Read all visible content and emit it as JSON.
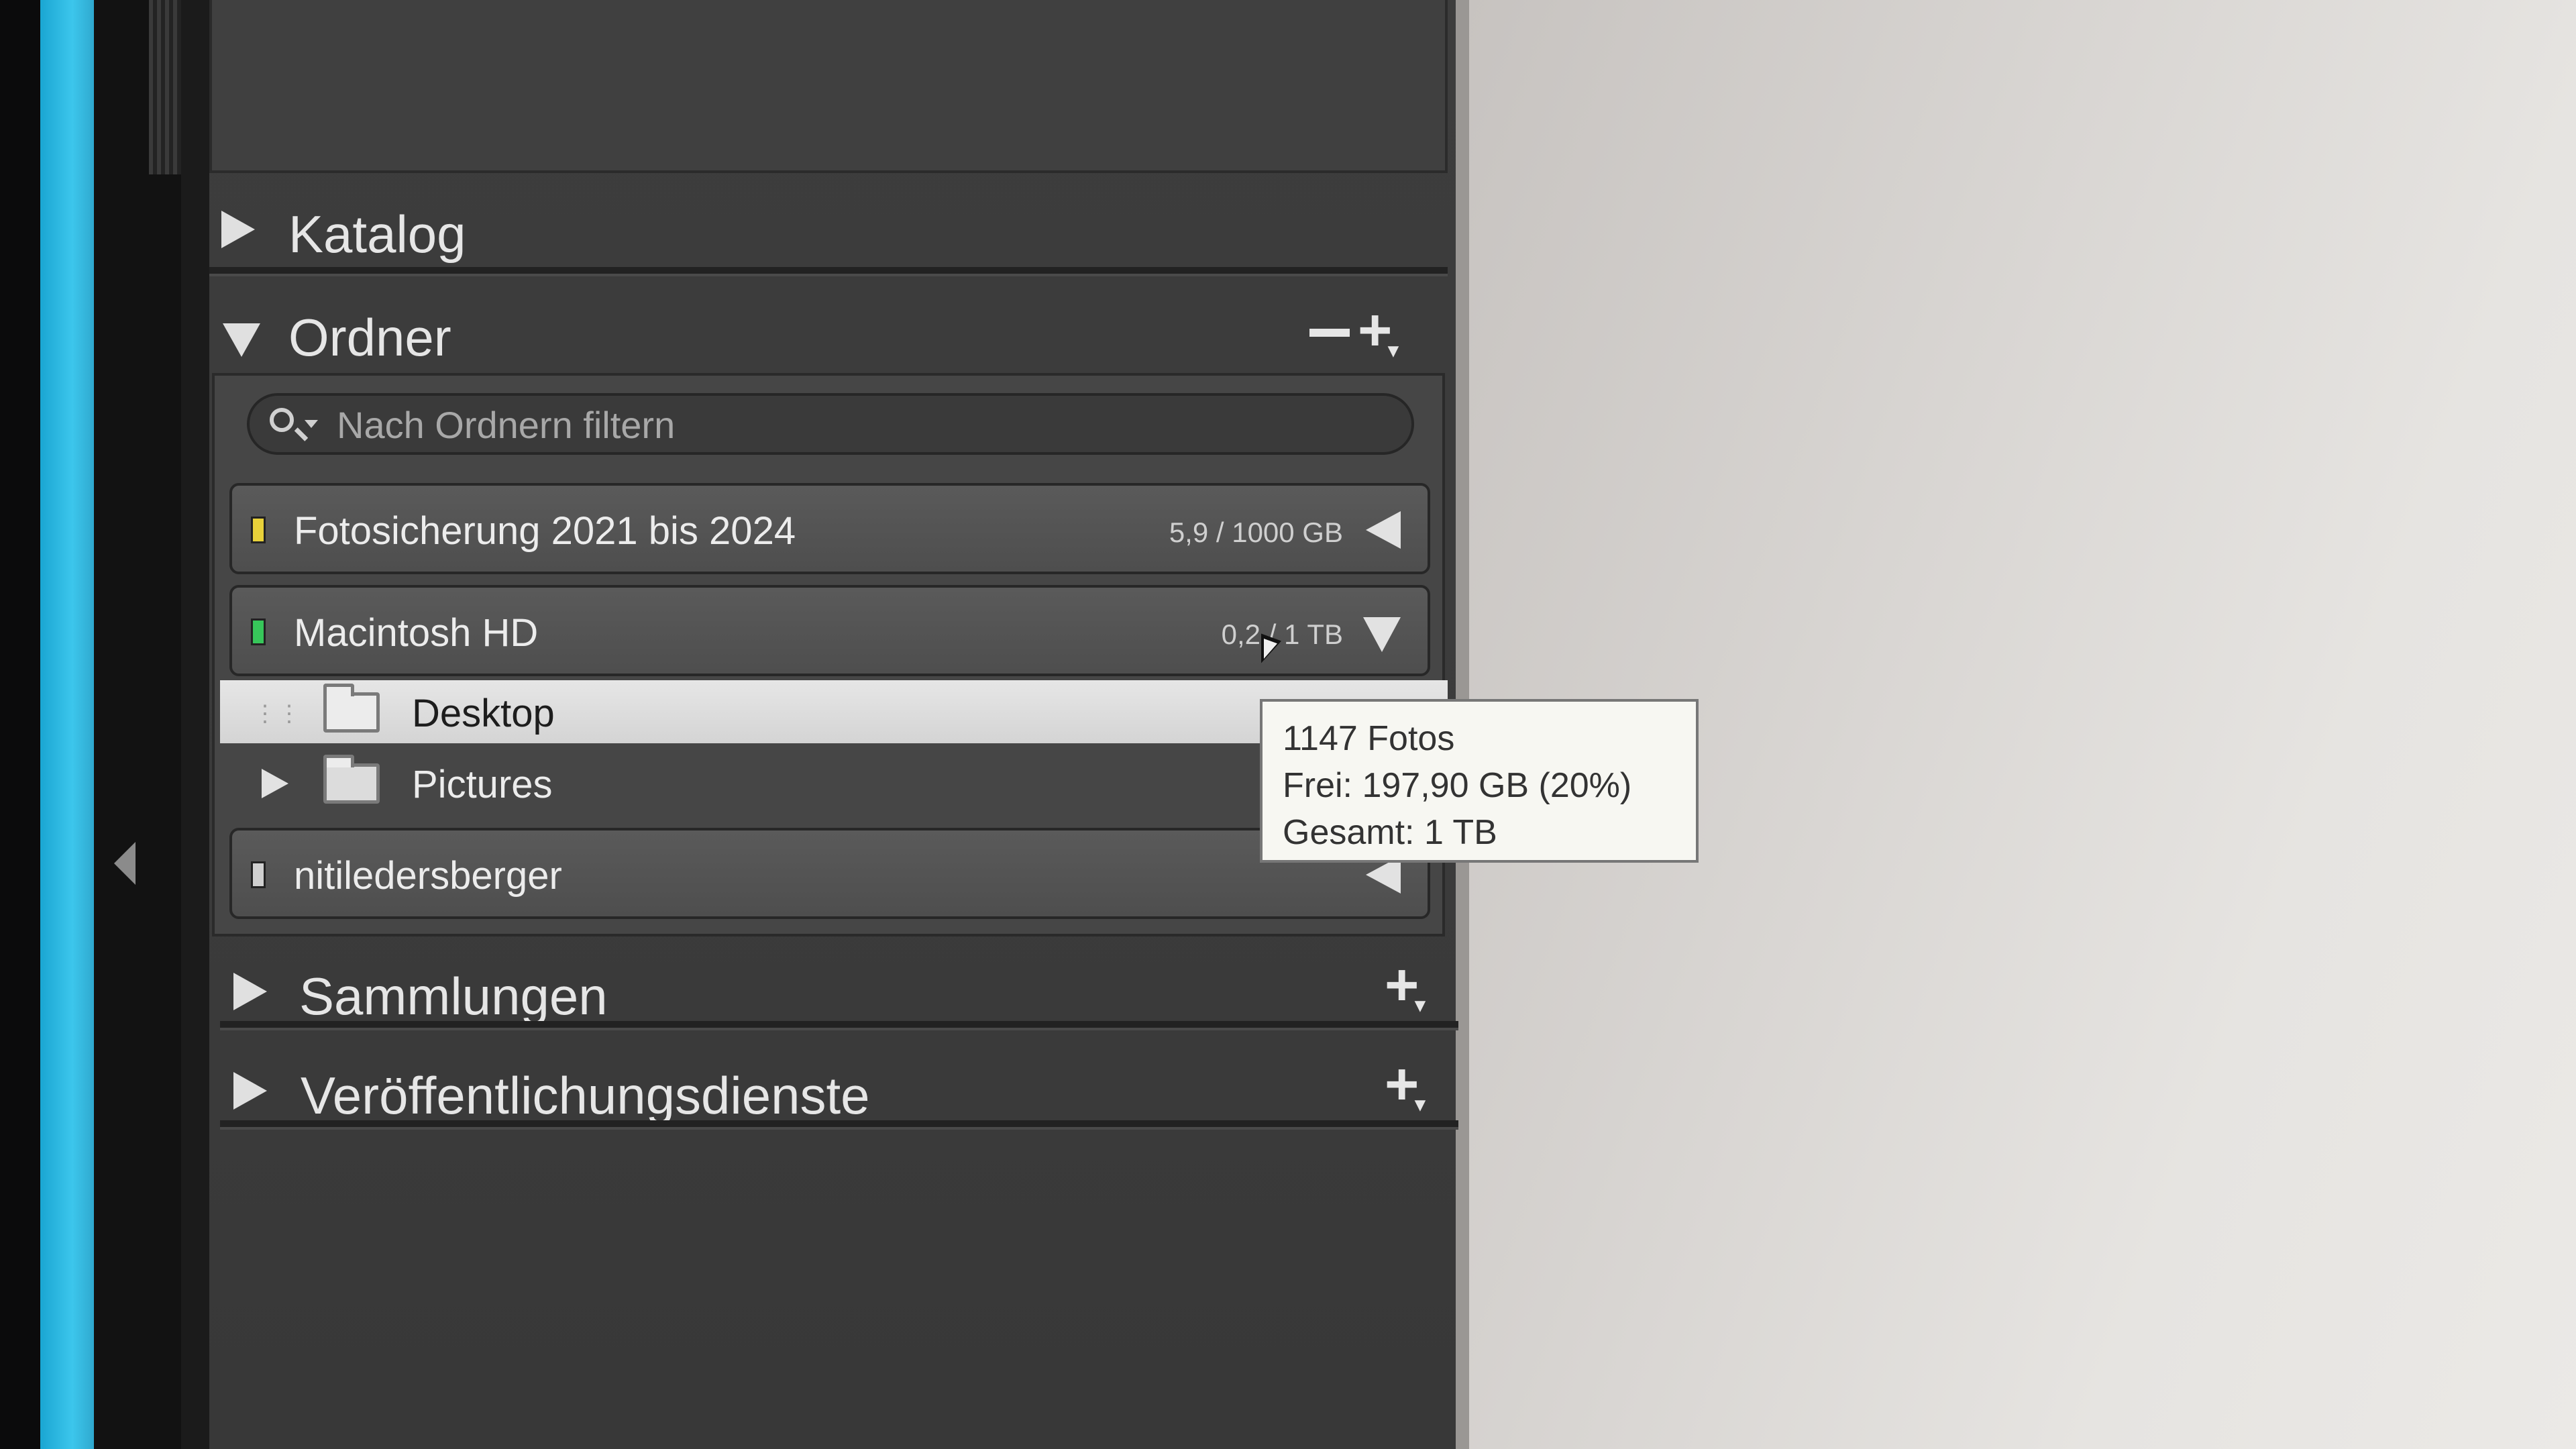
{
  "panel": {
    "sections": {
      "katalog": "Katalog",
      "ordner": "Ordner",
      "sammlungen": "Sammlungen",
      "veroeffentlichungsdienste": "Veröffentlichungsdienste"
    },
    "ordner_actions": {
      "remove": "−",
      "add": "+"
    },
    "search": {
      "placeholder": "Nach Ordnern filtern"
    },
    "volumes": [
      {
        "name": "Fotosicherung 2021 bis 2024",
        "capacity": "5,9 / 1000 GB",
        "indicator": "#e8d13a",
        "expanded": false
      },
      {
        "name": "Macintosh HD",
        "capacity": "0,2 / 1 TB",
        "indicator": "#37c65a",
        "expanded": true
      },
      {
        "name": "nitiledersberger",
        "capacity": "",
        "indicator": "#cfcfcf",
        "expanded": false
      }
    ],
    "folders": [
      {
        "name": "Desktop",
        "selected": true
      },
      {
        "name": "Pictures",
        "selected": false
      }
    ],
    "collapse_icon": "triangle-left-icon"
  },
  "tooltip": {
    "line1": "1147 Fotos",
    "line2": "Frei: 197,90 GB (20%)",
    "line3": "Gesamt: 1 TB"
  },
  "colors": {
    "panel_bg": "#3c3c3c",
    "selected_row": "#dcdcdc",
    "tooltip_bg": "#f7f7f2"
  }
}
